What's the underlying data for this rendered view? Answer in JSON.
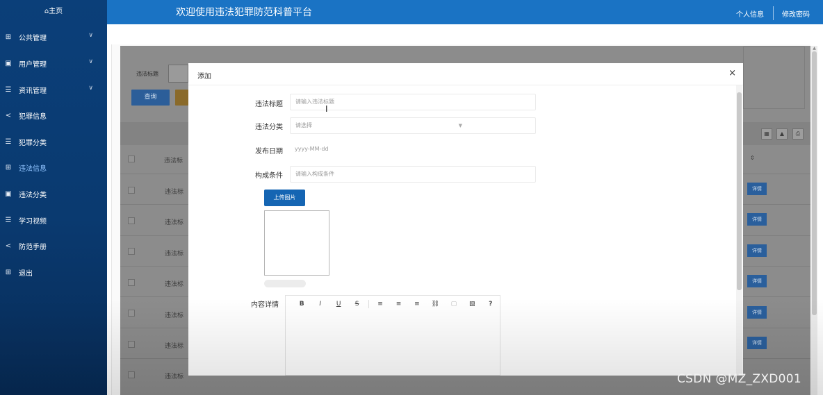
{
  "sidebar": {
    "home": "⌂主页",
    "items": [
      {
        "icon": "grid-icon",
        "glyph": "⊞",
        "label": "公共管理",
        "chevron": true
      },
      {
        "icon": "book-icon",
        "glyph": "▣",
        "label": "用户管理",
        "chevron": true
      },
      {
        "icon": "list-icon",
        "glyph": "☰",
        "label": "资讯管理",
        "chevron": true
      },
      {
        "icon": "share-icon",
        "glyph": "<",
        "label": "犯罪信息",
        "chevron": false
      },
      {
        "icon": "list-icon",
        "glyph": "☰",
        "label": "犯罪分类",
        "chevron": false
      },
      {
        "icon": "grid-icon",
        "glyph": "⊞",
        "label": "违法信息",
        "chevron": false,
        "active": true
      },
      {
        "icon": "book-icon",
        "glyph": "▣",
        "label": "违法分类",
        "chevron": false
      },
      {
        "icon": "list-icon",
        "glyph": "☰",
        "label": "学习视频",
        "chevron": false
      },
      {
        "icon": "share-icon",
        "glyph": "<",
        "label": "防范手册",
        "chevron": false
      },
      {
        "icon": "grid-icon",
        "glyph": "⊞",
        "label": "退出",
        "chevron": false
      }
    ]
  },
  "header": {
    "title": "欢迎使用违法犯罪防范科普平台",
    "profile": "个人信息",
    "change_password": "修改密码"
  },
  "background": {
    "search_label": "违法标题",
    "query_button": "查询",
    "row_cell": "违法标",
    "header_cell": "违法标",
    "detail_button": "详情",
    "sort_glyph": "⇕"
  },
  "modal": {
    "title": "添加",
    "close": "×",
    "fields": {
      "title_label": "违法标题",
      "title_placeholder": "请输入违法标题",
      "category_label": "违法分类",
      "category_placeholder": "请选择",
      "date_label": "发布日期",
      "date_placeholder": "yyyy-MM-dd",
      "condition_label": "构成条件",
      "condition_placeholder": "请输入构成条件",
      "upload_button": "上传图片",
      "content_label": "内容详情"
    },
    "editor_tools": [
      "B",
      "I",
      "U",
      "S",
      "≡",
      "≡",
      "≡",
      "⛓",
      "▢",
      "▨",
      "?"
    ]
  },
  "watermark": "CSDN @MZ_ZXD001"
}
